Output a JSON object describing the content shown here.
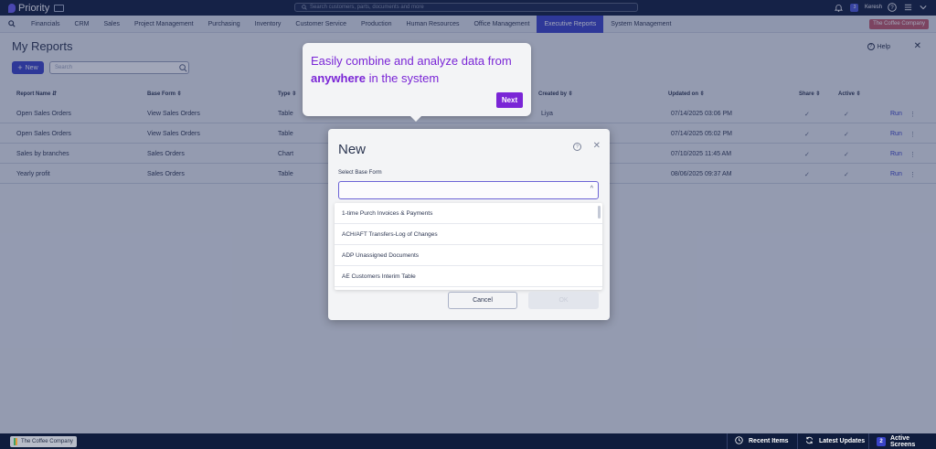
{
  "app": {
    "name": "Priority",
    "search_placeholder": "Search customers, parts, documents and more",
    "user": "Keresh",
    "user_badge": "3"
  },
  "menu": {
    "items": [
      "Financials",
      "CRM",
      "Sales",
      "Project Management",
      "Purchasing",
      "Inventory",
      "Customer Service",
      "Production",
      "Human Resources",
      "Office Management",
      "Executive Reports",
      "System Management"
    ],
    "active": "Executive Reports",
    "company_chip": "The Coffee Company"
  },
  "page": {
    "title": "My Reports",
    "help_label": "Help",
    "new_label": "New",
    "search_placeholder": "Search"
  },
  "table": {
    "headers": {
      "name": "Report Name",
      "base_form": "Base Form",
      "type": "Type",
      "created_by": "Created by",
      "updated_on": "Updated on",
      "share": "Share",
      "active": "Active"
    },
    "rows": [
      {
        "name": "Open Sales Orders",
        "base_form": "View Sales Orders",
        "type": "Table",
        "created_by": "Liya",
        "updated_on": "07/14/2025 03:06 PM",
        "run": "Run"
      },
      {
        "name": "Open Sales Orders",
        "base_form": "View Sales Orders",
        "type": "Table",
        "created_by": "",
        "updated_on": "07/14/2025 05:02 PM",
        "run": "Run"
      },
      {
        "name": "Sales by branches",
        "base_form": "Sales Orders",
        "type": "Chart",
        "created_by": "",
        "updated_on": "07/10/2025 11:45 AM",
        "run": "Run"
      },
      {
        "name": "Yearly profit",
        "base_form": "Sales Orders",
        "type": "Table",
        "created_by": "",
        "updated_on": "08/06/2025 09:37 AM",
        "run": "Run"
      }
    ]
  },
  "tooltip": {
    "text_before": "Easily combine and analyze data from ",
    "text_bold": "anywhere",
    "text_after": " in the system",
    "next_label": "Next"
  },
  "dialog": {
    "title": "New",
    "field_label": "Select Base Form",
    "select_value": "",
    "options": [
      "1-time Purch Invoices & Payments",
      "ACH/AFT Transfers-Log of Changes",
      "ADP Unassigned Documents",
      "AE Customers Interim Table"
    ],
    "cancel_label": "Cancel",
    "ok_label": "OK"
  },
  "bottom": {
    "company": "The Coffee Company",
    "recent_items": "Recent Items",
    "latest_updates": "Latest Updates",
    "active_screens": "Active Screens",
    "active_screens_count": "2"
  }
}
